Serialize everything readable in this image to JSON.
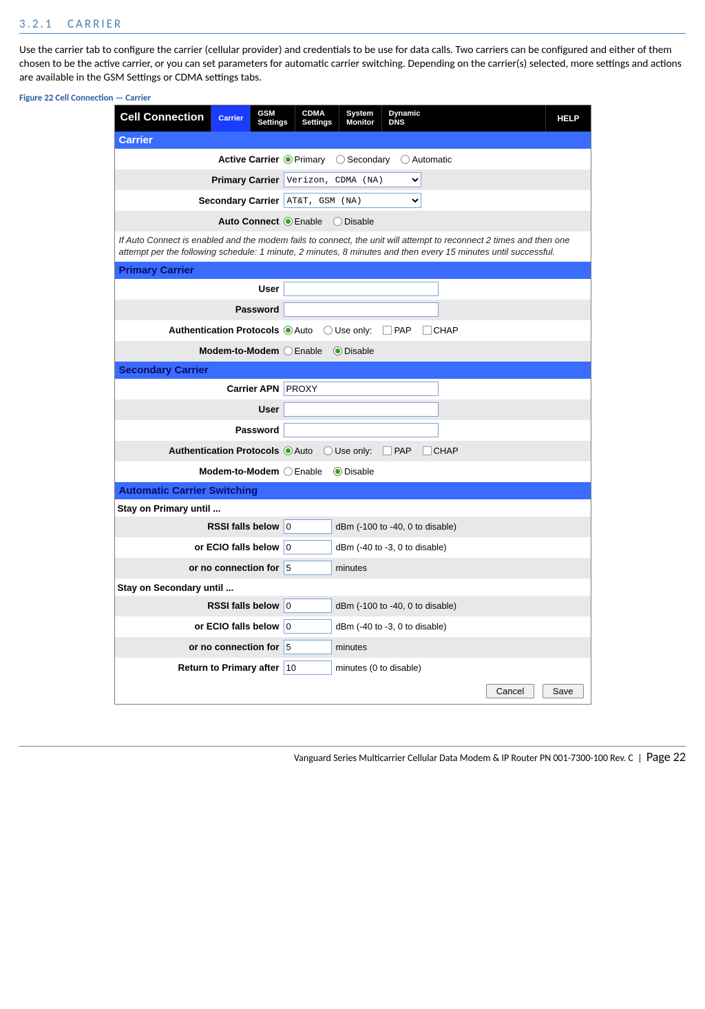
{
  "doc": {
    "section_number": "3.2.1",
    "section_title": "CARRIER",
    "intro": "Use the carrier tab to configure the carrier (cellular provider) and credentials to be use for data calls. Two carriers can be configured and either of them chosen to be the active carrier, or you can set parameters for automatic carrier switching. Depending on the carrier(s) selected, more settings and actions are available in the GSM Settings or CDMA settings tabs.",
    "figure_caption": "Figure 22 Cell Connection — Carrier",
    "footer_text": "Vanguard Series Multicarrier Cellular Data Modem & IP Router PN 001-7300-100 Rev. C",
    "page_label": "Page 22"
  },
  "panel": {
    "title": "Cell Connection",
    "tabs": {
      "carrier": "Carrier",
      "gsm": "GSM\nSettings",
      "cdma": "CDMA\nSettings",
      "sysmon": "System\nMonitor",
      "dns": "Dynamic\nDNS",
      "help": "HELP"
    },
    "sections": {
      "carrier": "Carrier",
      "primary": "Primary Carrier",
      "secondary": "Secondary Carrier",
      "autoswitch": "Automatic Carrier Switching"
    },
    "labels": {
      "active_carrier": "Active Carrier",
      "primary_carrier": "Primary Carrier",
      "secondary_carrier": "Secondary Carrier",
      "auto_connect": "Auto Connect",
      "user": "User",
      "password": "Password",
      "auth_protocols": "Authentication Protocols",
      "modem_to_modem": "Modem-to-Modem",
      "carrier_apn": "Carrier APN",
      "stay_primary": "Stay on Primary until ...",
      "stay_secondary": "Stay on Secondary until ...",
      "rssi_below": "RSSI falls below",
      "ecio_below": "or ECIO falls below",
      "no_conn_for": "or no connection for",
      "return_primary": "Return to Primary after"
    },
    "options": {
      "primary": "Primary",
      "secondary": "Secondary",
      "automatic": "Automatic",
      "enable": "Enable",
      "disable": "Disable",
      "auto": "Auto",
      "use_only": "Use only:",
      "pap": "PAP",
      "chap": "CHAP"
    },
    "values": {
      "primary_carrier_select": "Verizon, CDMA (NA)",
      "secondary_carrier_select": "AT&T, GSM (NA)",
      "carrier_apn": "PROXY",
      "p_rssi": "0",
      "p_ecio": "0",
      "p_noconn": "5",
      "s_rssi": "0",
      "s_ecio": "0",
      "s_noconn": "5",
      "return_after": "10"
    },
    "hints": {
      "rssi": "dBm (-100 to -40, 0 to disable)",
      "ecio": "dBm (-40 to -3, 0 to disable)",
      "minutes": "minutes",
      "minutes_disable": "minutes (0 to disable)"
    },
    "note": "If Auto Connect is enabled and the modem fails to connect, the unit will attempt to reconnect 2 times and then one attempt per the following schedule: 1 minute, 2 minutes, 8 minutes and then every 15 minutes until successful.",
    "buttons": {
      "cancel": "Cancel",
      "save": "Save"
    }
  }
}
